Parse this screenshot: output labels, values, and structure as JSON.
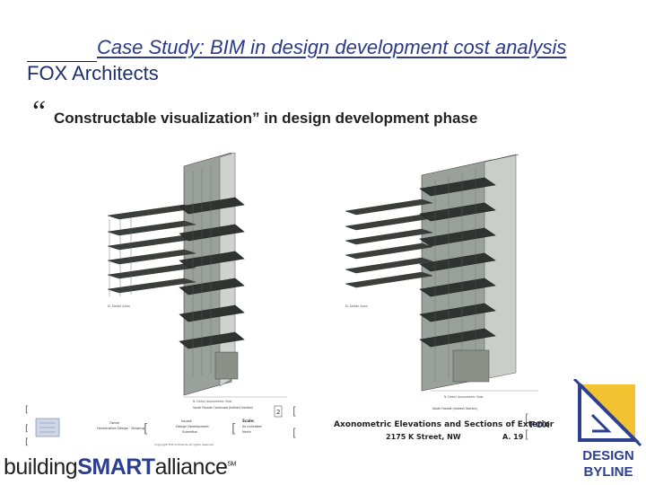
{
  "slide": {
    "title": "Case Study: BIM in design development cost analysis",
    "subtitle": "FOX Architects",
    "quote_mark": "“",
    "caption": "Constructable visualization” in design development phase"
  },
  "title_block": {
    "sheet_title": "Axonometric Elevations and Sections of Exterior",
    "address": "2175 K Street, NW",
    "sheet_number": "A. 19"
  },
  "logos": {
    "bsa_prefix": "building",
    "bsa_strong": "SMART",
    "bsa_suffix": "alliance",
    "bsa_mark": "SM",
    "design_byline_line1": "DESIGN",
    "design_byline_line2": "BYLINE"
  },
  "colors": {
    "title": "#2b3a8a",
    "bsa_blue": "#2d3f8f",
    "byline_blue": "#2d3f8f",
    "byline_yellow": "#f2c230"
  }
}
